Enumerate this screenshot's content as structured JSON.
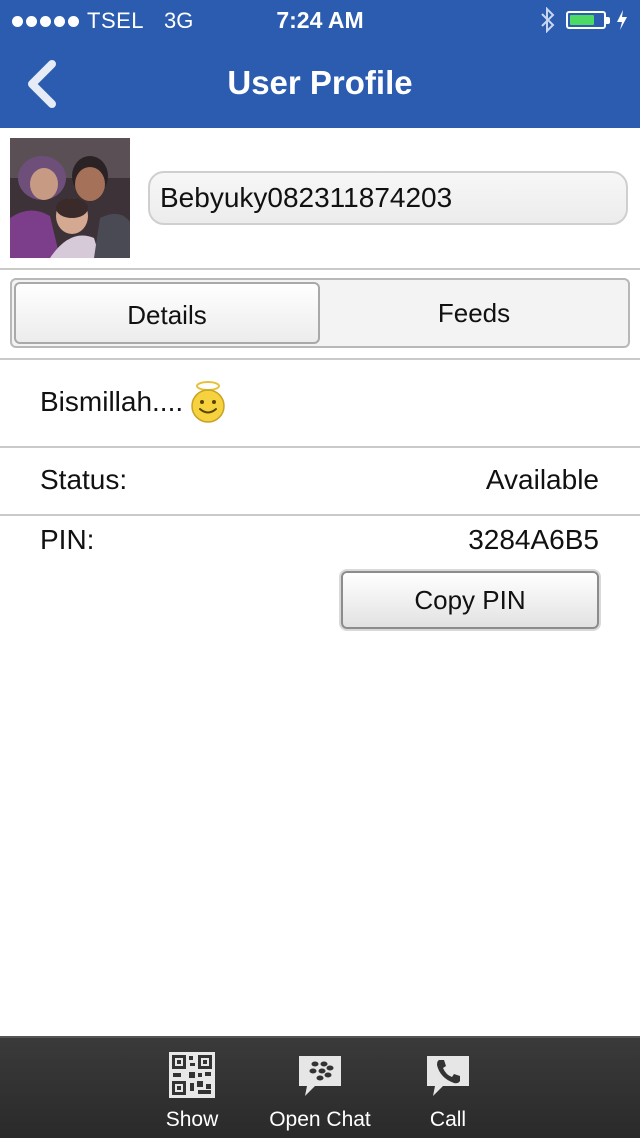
{
  "status_bar": {
    "carrier": "TSEL",
    "network": "3G",
    "time": "7:24 AM",
    "signal_dots": 5,
    "battery_level": 0.75,
    "icons": [
      "bluetooth-icon",
      "battery-icon",
      "charging-icon"
    ]
  },
  "navbar": {
    "title": "User Profile",
    "back_icon": "chevron-left-icon"
  },
  "profile": {
    "display_name": "Bebyuky082311874203"
  },
  "tabs": [
    {
      "label": "Details",
      "selected": true
    },
    {
      "label": "Feeds",
      "selected": false
    }
  ],
  "details": {
    "personal_message": "Bismillah....",
    "message_emoticon": "angel-smiley-icon",
    "status_label": "Status:",
    "status_value": "Available",
    "pin_label": "PIN:",
    "pin_value": "3284A6B5",
    "copy_pin_label": "Copy PIN"
  },
  "toolbar": {
    "items": [
      {
        "label": "Show",
        "icon": "qr-code-icon"
      },
      {
        "label": "Open Chat",
        "icon": "chat-bubble-icon"
      },
      {
        "label": "Call",
        "icon": "phone-icon"
      }
    ]
  },
  "colors": {
    "header_bg": "#2b5cb0",
    "toolbar_bg": "#2e2e2e",
    "battery_fill": "#4cd964"
  }
}
